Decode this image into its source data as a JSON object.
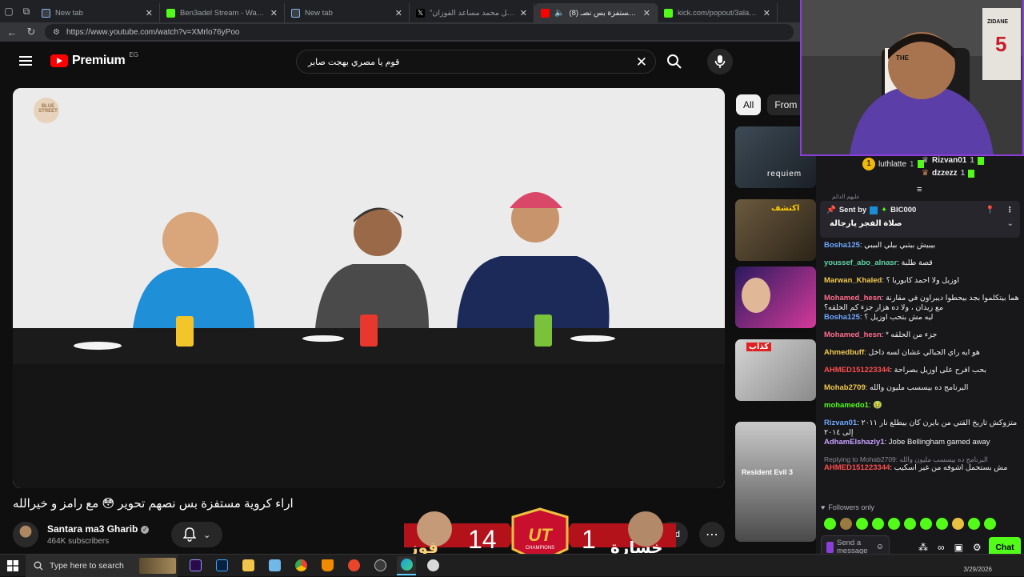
{
  "browser": {
    "tabs": [
      {
        "label": "New tab",
        "color": "#8ab4f8"
      },
      {
        "label": "Ben3adel Stream - Watch Live on",
        "color": "#53fc18"
      },
      {
        "label": "New tab",
        "color": "#8ab4f8"
      },
      {
        "label": "\"هل محمد مساعد الفوزان on X",
        "color": "#ffffff"
      },
      {
        "label": "(8) اراء كروية مستفزة بس نصـ",
        "color": "#ff0000"
      },
      {
        "label": "kick.com/popout/3alawyhd/",
        "color": "#53fc18"
      }
    ],
    "url": "https://www.youtube.com/watch?v=XMrlo76yPoo"
  },
  "youtube": {
    "logo_text": "Premium",
    "country_code": "EG",
    "search_query": "قوم يا مصري بهجت صابر",
    "video_title": "اراء كروية مستفزة بس نصهم تحوير 😳 مع رامز و خيرالله",
    "channel_name": "Santara ma3 Gharib",
    "subscribers": "464K subscribers",
    "download_label": "oad",
    "chips": [
      {
        "label": "All",
        "selected": true
      },
      {
        "label": "From",
        "selected": false
      }
    ],
    "thumbnails": [
      "requiem",
      "اكتشف",
      "",
      "كذاب",
      "Resident Evil 3"
    ],
    "watermark_text": "BLUE STREET"
  },
  "stream_overlay": {
    "win_label": "فوز",
    "win_score": "14",
    "lose_score": "1",
    "lose_label": "خسارة",
    "center_badge": "UT",
    "center_sub": "CHAMPIONS"
  },
  "webcam": {
    "jersey_top": "THE",
    "jersey_name": "ZIDANE",
    "jersey_number": "5"
  },
  "chat": {
    "leaderboard": [
      {
        "rank": "1",
        "user": "luthlatte",
        "count": "1"
      },
      {
        "user": "Rizvan01",
        "count": "1"
      },
      {
        "user": "dzzezz",
        "count": "1"
      }
    ],
    "pinned_sender_label": "Sent by",
    "pinned_sender": "BIC000",
    "pinned_message": "صلاة الفجر يارجالة",
    "pinned_caption": "عليهم الدائم",
    "messages": [
      {
        "user": "Bosha125",
        "color": "#6fa8ff",
        "text": "بيبيش بيتبي بيلي البيبي"
      },
      {
        "user": "youssef_abo_alnasr",
        "color": "#5fd3a5",
        "text": "قصة طلبة"
      },
      {
        "user": "Marwan_Khaled",
        "color": "#f2c94c",
        "text": "اوزيل ولا احمد كابوريا ؟"
      },
      {
        "user": "Mohamed_hesn",
        "color": "#ff6b8b",
        "text": "هما بيتكلموا بجد بيحطوا ديبراون في مقارنة مع زيدان ، ولا ده هزار جزء كم الحلقه؟"
      },
      {
        "user": "Bosha125",
        "color": "#6fa8ff",
        "text": "ليه مش بتحب اوزيل ؟"
      },
      {
        "user": "Mohamed_hesn",
        "color": "#ff6b8b",
        "text": "جزء من الحلقه *"
      },
      {
        "user": "Ahmedbuff",
        "color": "#f2c94c",
        "text": "هو ايه راي الجبالي عشان لسه داخل"
      },
      {
        "user": "AHMED151223344",
        "color": "#ff4d4d",
        "text": "بحب افرح على اوزيل بصراحة"
      },
      {
        "user": "Mohab2709",
        "color": "#f2c94c",
        "text": "البرنامج ده بيسسب مليون والله"
      },
      {
        "user": "mohamedo1",
        "color": "#53fc18",
        "text": "🤢"
      },
      {
        "user": "Rizvan01",
        "color": "#6fa8ff",
        "text": "متزوكش تاريخ القتي من بايرن كان بيطلع نار ٢٠١١ إلى ٢٠١٤"
      },
      {
        "user": "AdhamElshazly1",
        "color": "#c9a0ff",
        "text": "Jobe Bellingham gamed away"
      },
      {
        "user": "AHMED151223344",
        "color": "#ff4d4d",
        "text": "مش بستحمل اشوفه من غير اسكيب",
        "reply": "Replying to Mohab2709: البرنامج ده بيسسب مليون والله"
      }
    ],
    "followers_only": "Followers only",
    "input_placeholder": "Send a message",
    "send_label": "Chat"
  },
  "taskbar": {
    "search_placeholder": "Type here to search",
    "date": "3/29/2026"
  }
}
